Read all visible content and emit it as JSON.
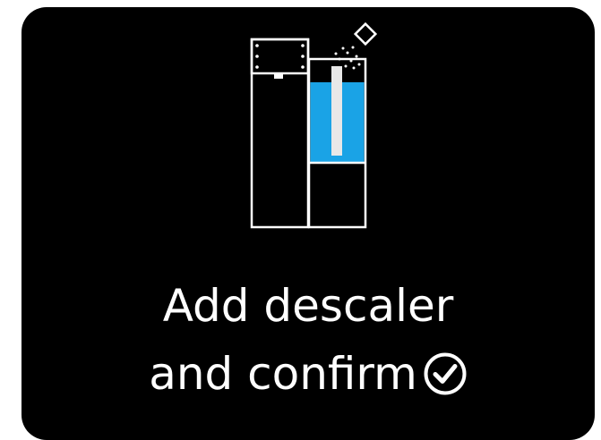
{
  "prompt": {
    "line1": "Add descaler",
    "line2": "and confirm"
  },
  "icons": {
    "illustration": "coffee-machine-descaler-icon",
    "confirm": "check-circle-icon"
  },
  "colors": {
    "background": "#000000",
    "foreground": "#ffffff",
    "water": "#1aa3e6"
  }
}
